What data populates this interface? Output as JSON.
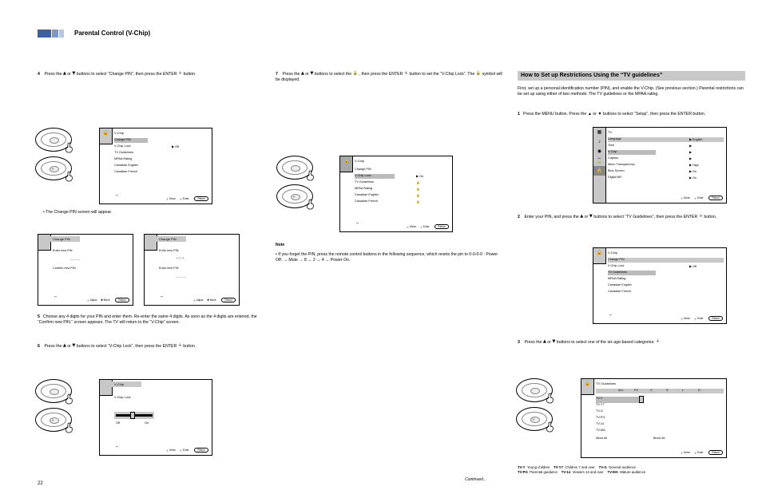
{
  "header": {
    "page_number": "22",
    "section_label": "Parental Control (V-Chip)"
  },
  "icons": {
    "up": "▲",
    "down": "▼",
    "enter": "＋",
    "lock": "🔒",
    "unlock": "🔓",
    "return": "↩",
    "move": "＋",
    "enter_label": "Enter",
    "return_label": "Return",
    "move_label": "Move",
    "picture": "▦",
    "sound": "♪",
    "channel": "◉",
    "setup": "⌛"
  },
  "col1": {
    "step4": {
      "label": "4",
      "text_a": "Press the ",
      "text_b": " buttons to select “Change PIN”, then press the ENTER",
      "text_c": " button."
    },
    "screen4": {
      "title": "V-Chip",
      "rows": [
        "Change PIN",
        "V-Chip Lock",
        "TV Guidelines",
        "MPAA Rating",
        "Canadian English",
        "Canadian French"
      ],
      "rows_r": [
        "",
        "",
        "",
        "",
        "",
        ""
      ],
      "lock_state": "▶ Off",
      "foot_move": "Move",
      "foot_enter": "Enter",
      "foot_return": "Return"
    },
    "note4": "• The Change PIN screen will appear.",
    "screen5a": {
      "title": "Change PIN",
      "line1": "Enter new PIN",
      "line2": "Confirm new PIN",
      "fields": "_ _ _ _",
      "foot_adjust": "Adjust",
      "foot_move": "Move",
      "foot_return": "Return"
    },
    "screen5b": {
      "title": "Change PIN",
      "line1": "Enter new PIN",
      "line2": "Enter new PIN",
      "fields": "* * * *",
      "fields2": "_ _ _ _",
      "foot_adjust": "Adjust",
      "foot_move": "Move",
      "foot_return": "Return"
    },
    "step5": {
      "label": "5",
      "text": "Choose any 4 digits for your PIN and enter them. Re-enter the same 4 digits. As soon as the 4 digits are entered, the “Confirm new PIN.” screen appears. The TV will return to the “V-Chip” screen. "
    },
    "step6": {
      "label": "6",
      "text_a": "Press the ",
      "text_b": " buttons to select “V-Chip Lock”, then press the ENTER",
      "text_c": " button."
    },
    "screen6": {
      "title": "V-Chip",
      "row": "V-Chip Lock",
      "slider_left": "Off",
      "slider_right": "On",
      "foot_move": "Move",
      "foot_enter": "Enter",
      "foot_return": "Return"
    },
    "end": "Continued..."
  },
  "col2": {
    "step7": {
      "label": "7",
      "text_a": "Press the ",
      "text_b": " buttons to select the ",
      "text_c": ", then press the ENTER",
      "text_d": " button to set the “V-Chip Lock”. The  ",
      "text_e": " symbol will be displayed."
    },
    "screen7": {
      "title": "V-Chip",
      "rows": [
        "Change PIN",
        "V-Chip Lock",
        "TV Guidelines",
        "MPAA Rating",
        "Canadian English",
        "Canadian French"
      ],
      "locks": [
        "▶",
        "🔒",
        "🔒",
        "🔒",
        "🔒",
        "🔒"
      ],
      "vchip": "On",
      "foot_move": "Move",
      "foot_enter": "Enter",
      "foot_return": "Return"
    },
    "note": "Note",
    "note_txt": "• If you forget the PIN, press the remote control buttons in the following sequence, which resets the pin to 0-0-0-0 : Power Off. → Mute → 8 → 2 → 4 → Power On."
  },
  "col3": {
    "title": "How to Set up Restrictions Using the “TV guidelines”",
    "intro": "First, set up a personal identification number (PIN), and enable the V-Chip. (See previous section.) Parental restrictions can be set up using either of two methods: The TV guidelines or the MPAA rating.",
    "step1": {
      "label": "1",
      "text": "Press the MENU button. Press the ▲ or ▼ buttons to select “Setup”, then press the ENTER  button."
    },
    "screen1": {
      "menu": [
        "Picture",
        "Sound",
        "Channel",
        "Setup"
      ],
      "sel": "Setup",
      "items": [
        "Language",
        "Time",
        "V-Chip",
        "Caption",
        "Menu Transparency",
        "Blue Screen",
        "Digital NR"
      ],
      "items_r": [
        "▶ English",
        "▶",
        "▶",
        "▶",
        "▶ High",
        "▶ On",
        "▶ On"
      ],
      "title": "TV",
      "foot_move": "Move",
      "foot_enter": "Enter",
      "foot_return": "Return"
    },
    "step2": {
      "label": "2",
      "text_a": "Enter your PIN, and press the ",
      "text_b": " buttons to select “TV Guidelines”, then press the ENTER",
      "text_c": " button."
    },
    "screen2": {
      "title": "V-Chip",
      "rows": [
        "Change PIN",
        "V-Chip Lock",
        "TV Guidelines",
        "MPAA Rating",
        "Canadian English",
        "Canadian French"
      ],
      "lock_state": "▶ Off",
      "foot_move": "Move",
      "foot_enter": "Enter",
      "foot_return": "Return"
    },
    "step3": {
      "label": "3",
      "text_a": "Press the ",
      "text_b": " buttons to select one of the six age-based categories:",
      "text_c": " button."
    },
    "screen3": {
      "title": "TV Guidelines",
      "cols": [
        "",
        "ALL",
        "FV",
        "V",
        "S",
        "L",
        "D"
      ],
      "rows": [
        "TV-Y",
        "TV-Y7",
        "TV-G",
        "TV-PG",
        "TV-14",
        "TV-MA"
      ],
      "allow": "Allow All",
      "block": "Block All",
      "foot_move": "Move",
      "foot_enter": "Enter",
      "foot_return": "Return"
    },
    "cats": {
      "TV-Y": "Young children",
      "TV-Y7": "Children 7 and over",
      "TV-G": "General audience",
      "TV-PG": "Parental guidance",
      "TV-14": "Viewers 14 and over",
      "TV-MA": "Mature audience"
    }
  }
}
